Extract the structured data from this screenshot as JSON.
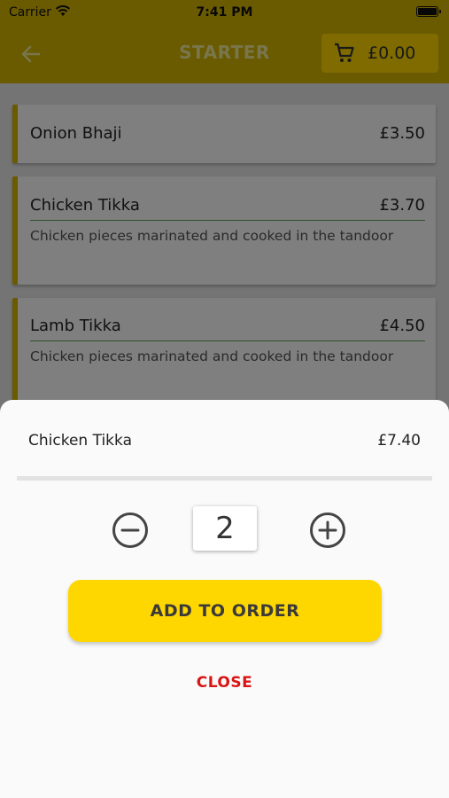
{
  "status_bar": {
    "carrier": "Carrier",
    "time": "7:41 PM"
  },
  "header": {
    "title": "STARTER",
    "cart_total": "£0.00",
    "back_icon": "arrow-left-icon",
    "cart_icon": "shopping-cart-icon"
  },
  "menu": {
    "items": [
      {
        "name": "Onion Bhaji",
        "price": "£3.50",
        "description": ""
      },
      {
        "name": "Chicken Tikka",
        "price": "£3.70",
        "description": "Chicken pieces marinated and cooked in the tandoor"
      },
      {
        "name": "Lamb Tikka",
        "price": "£4.50",
        "description": "Chicken pieces marinated and cooked in the tandoor"
      }
    ]
  },
  "sheet": {
    "item_name": "Chicken Tikka",
    "item_price": "£7.40",
    "quantity": "2",
    "add_label": "ADD TO ORDER",
    "close_label": "CLOSE"
  },
  "colors": {
    "brand": "#ffd700",
    "header_bg": "#d4b400",
    "close": "#d91414",
    "rule": "#5aa05a"
  }
}
